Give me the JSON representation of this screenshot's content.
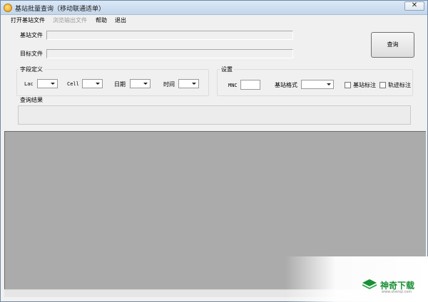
{
  "window": {
    "title": "基站批量查询（移动联通适单）",
    "close_glyph": "✕"
  },
  "menu": [
    {
      "label": "打开基站文件",
      "enabled": true
    },
    {
      "label": "浏览输出文件",
      "enabled": false
    },
    {
      "label": "帮助",
      "enabled": true
    },
    {
      "label": "退出",
      "enabled": true
    }
  ],
  "files": {
    "station_label": "基站文件",
    "station_value": "",
    "target_label": "目标文件",
    "target_value": ""
  },
  "query_button": "查询",
  "fields": {
    "title": "字段定义",
    "lac_label": "Lac",
    "cell_label": "Cell",
    "date_label": "日期",
    "time_label": "时间"
  },
  "settings": {
    "title": "设置",
    "mnc_label": "MNC",
    "mnc_value": "",
    "format_label": "基站格式",
    "station_mark_label": "基站标注",
    "track_mark_label": "轨迹标注",
    "station_mark_checked": false,
    "track_mark_checked": false
  },
  "result": {
    "label": "查询结果",
    "value": ""
  },
  "watermark": {
    "brand": "神奇下载",
    "sub": "www.shenqi.com"
  },
  "colors": {
    "grid_bg": "#ababab",
    "window_bg": "#f0f0f0",
    "brand_green": "#1a8f34"
  }
}
